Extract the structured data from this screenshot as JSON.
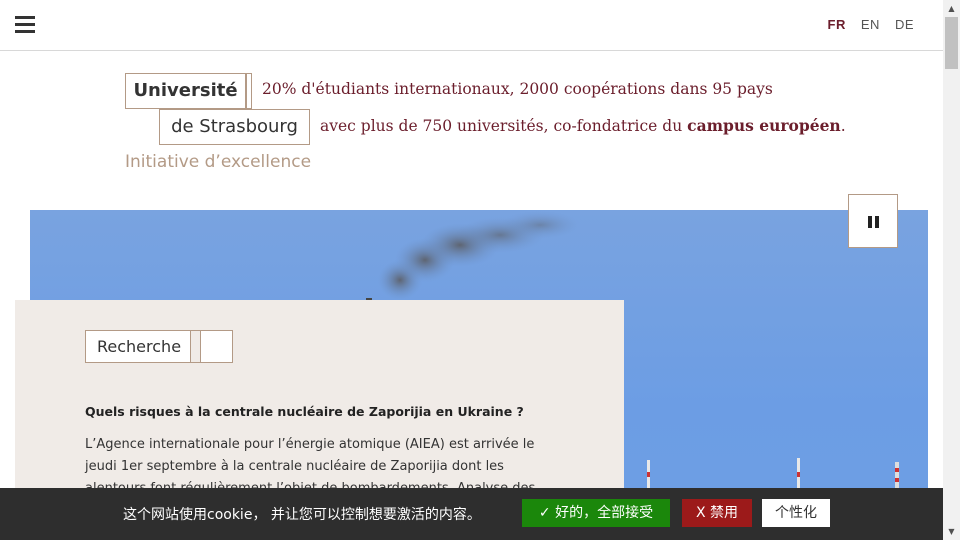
{
  "nav": {
    "menu_icon": "hamburger-icon",
    "languages": [
      {
        "code": "FR",
        "active": true
      },
      {
        "code": "EN",
        "active": false
      },
      {
        "code": "DE",
        "active": false
      }
    ]
  },
  "header": {
    "logo_line1": "Université",
    "logo_line2": "de Strasbourg",
    "tagline_line1": "20% d'étudiants internationaux, 2000 coopérations dans 95 pays",
    "tagline_line2_prefix": "avec plus de 750 universités, co-fondatrice du ",
    "tagline_line2_bold": "campus européen",
    "tagline_line2_suffix": ".",
    "initiative": "Initiative d’excellence"
  },
  "hero": {
    "pause_icon": "pause-icon"
  },
  "news_card": {
    "tag": "Recherche",
    "title": "Quels risques à la centrale nucléaire de Zaporijia en Ukraine ?",
    "text": "L’Agence internationale pour l’énergie atomique (AIEA) est arrivée le jeudi 1er septembre à la centrale nucléaire de Zaporijia dont les alentours font régulièrement l’objet de bombardements. Analyse des risques que"
  },
  "cookie_banner": {
    "message": "这个网站使用cookie， 并让您可以控制想要激活的内容。",
    "accept_label": "✓ 好的，全部接受",
    "deny_label": "X 禁用",
    "customize_label": "个性化",
    "colors": {
      "accept": "#1b870b",
      "deny": "#9c1a1a",
      "background": "#2e2e2e"
    }
  },
  "colors": {
    "brand": "#6b1e2c",
    "accent_beige": "#b39a86",
    "card_bg": "#f0ebe7"
  }
}
